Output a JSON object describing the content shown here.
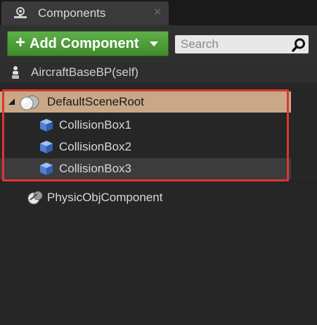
{
  "tab": {
    "title": "Components",
    "icon": "components-icon",
    "close_glyph": "✕"
  },
  "toolbar": {
    "add_plus": "+",
    "add_label": "Add Component",
    "add_color": "#4a9d35",
    "search_placeholder": "Search"
  },
  "tree": {
    "self_label": "AircraftBaseBP(self)",
    "root": {
      "label": "DefaultSceneRoot",
      "highlight_color": "#c8a886"
    },
    "children": [
      {
        "label": "CollisionBox1"
      },
      {
        "label": "CollisionBox2"
      },
      {
        "label": "CollisionBox3"
      }
    ],
    "physic_label": "PhysicObjComponent"
  },
  "annotation": {
    "color": "#e0362e"
  }
}
